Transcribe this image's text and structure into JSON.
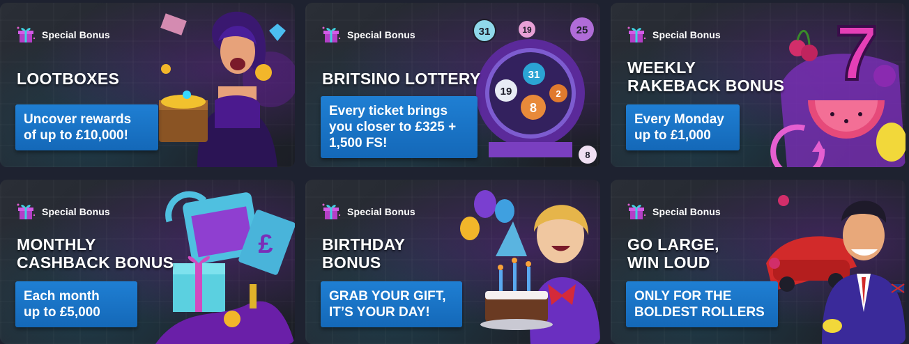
{
  "promotions": [
    {
      "badge": "Special Bonus",
      "title": [
        "LOOTBOXES"
      ],
      "promo": "Uncover rewards\nof up to £10,000!",
      "art": "treasure-chest-girl"
    },
    {
      "badge": "Special Bonus",
      "title": [
        "BRITSINO LOTTERY"
      ],
      "promo": "Every ticket brings\nyou closer to £325 +\n1,500 FS!",
      "art": "lottery-machine",
      "balls": [
        "31",
        "19",
        "25",
        "31",
        "19",
        "8",
        "2",
        "8"
      ]
    },
    {
      "badge": "Special Bonus",
      "title": [
        "WEEKLY",
        "RAKEBACK BONUS"
      ],
      "promo": "Every Monday\nup to £1,000",
      "art": "fruit-slot",
      "seven": "7"
    },
    {
      "badge": "Special Bonus",
      "title": [
        "MONTHLY",
        "CASHBACK BONUS"
      ],
      "promo": "Each month\nup to £5,000",
      "art": "calendar-gift",
      "currency": "£"
    },
    {
      "badge": "Special Bonus",
      "title": [
        "BIRTHDAY",
        "BONUS"
      ],
      "promo": "GRAB YOUR GIFT,\nIT’S YOUR DAY!",
      "art": "birthday-cake"
    },
    {
      "badge": "Special Bonus",
      "title": [
        "GO LARGE,",
        "WIN LOUD"
      ],
      "promo": "ONLY FOR THE\nBOLDEST ROLLERS",
      "art": "high-roller"
    }
  ]
}
